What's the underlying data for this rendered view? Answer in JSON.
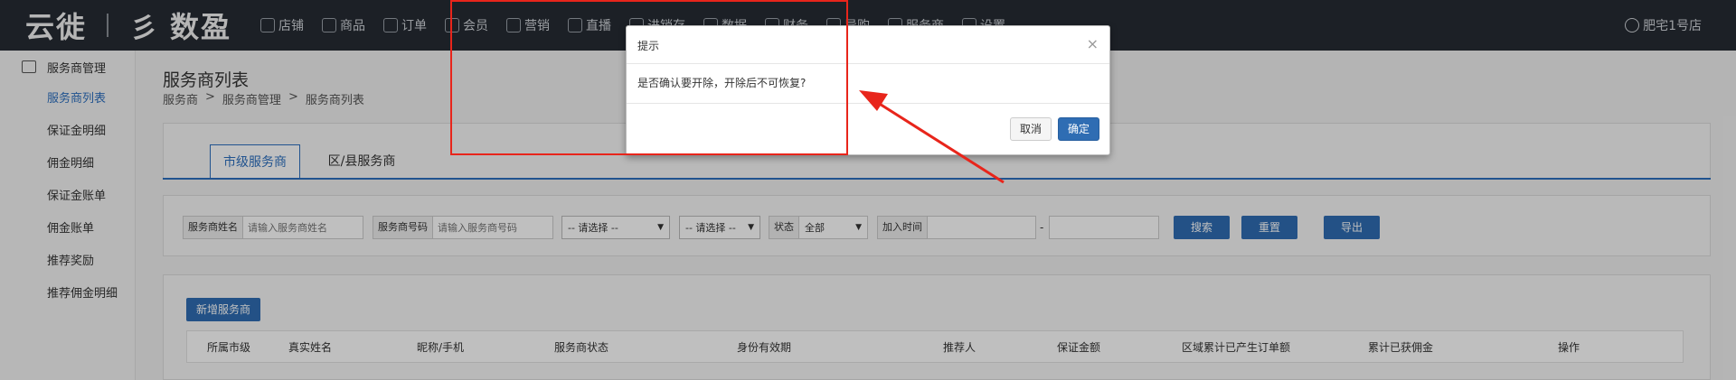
{
  "topbar": {
    "brand_primary": "云徙",
    "brand_secondary": "数盈",
    "nav": [
      {
        "label": "店铺",
        "icon": "home-icon"
      },
      {
        "label": "商品",
        "icon": "box-icon"
      },
      {
        "label": "订单",
        "icon": "cart-icon"
      },
      {
        "label": "会员",
        "icon": "user-icon"
      },
      {
        "label": "营销",
        "icon": "tag-icon"
      },
      {
        "label": "直播",
        "icon": "home-icon"
      },
      {
        "label": "进销存",
        "icon": "warehouse-icon"
      },
      {
        "label": "数据",
        "icon": "chart-icon"
      },
      {
        "label": "财务",
        "icon": "money-icon"
      },
      {
        "label": "导购",
        "icon": "guide-icon"
      },
      {
        "label": "服务商",
        "icon": "store-icon"
      },
      {
        "label": "设置",
        "icon": "gear-icon"
      }
    ],
    "user": "肥宅1号店"
  },
  "sidebar": {
    "group": "服务商管理",
    "items": [
      {
        "label": "服务商列表",
        "active": true
      },
      {
        "label": "保证金明细"
      },
      {
        "label": "佣金明细"
      },
      {
        "label": "保证金账单"
      },
      {
        "label": "佣金账单"
      },
      {
        "label": "推荐奖励"
      },
      {
        "label": "推荐佣金明细"
      }
    ]
  },
  "main": {
    "title": "服务商列表",
    "breadcrumb": [
      "服务商",
      ">",
      "服务商管理",
      ">",
      "服务商列表"
    ],
    "tabs": [
      {
        "label": "市级服务商",
        "active": true
      },
      {
        "label": "区/县服务商"
      }
    ],
    "filters": {
      "name_label": "服务商姓名",
      "name_placeholder": "请输入服务商姓名",
      "code_label": "服务商号码",
      "code_placeholder": "请输入服务商号码",
      "select1": "-- 请选择 --",
      "select2": "-- 请选择 --",
      "status_label": "状态",
      "status_value": "全部",
      "join_label": "加入时间",
      "date_sep": "-"
    },
    "buttons": {
      "search": "搜索",
      "reset": "重置",
      "export": "导出",
      "add": "新增服务商"
    },
    "table_headers": [
      "所属市级",
      "真实姓名",
      "昵称/手机",
      "服务商状态",
      "身份有效期",
      "推荐人",
      "保证金额",
      "区域累计已产生订单额",
      "累计已获佣金",
      "操作"
    ]
  },
  "modal": {
    "title": "提示",
    "message": "是否确认要开除，开除后不可恢复?",
    "cancel": "取消",
    "ok": "确定",
    "close": "×"
  },
  "colors": {
    "accent": "#2f6db3",
    "annotation": "#e8251b",
    "topbar": "#262b33"
  }
}
